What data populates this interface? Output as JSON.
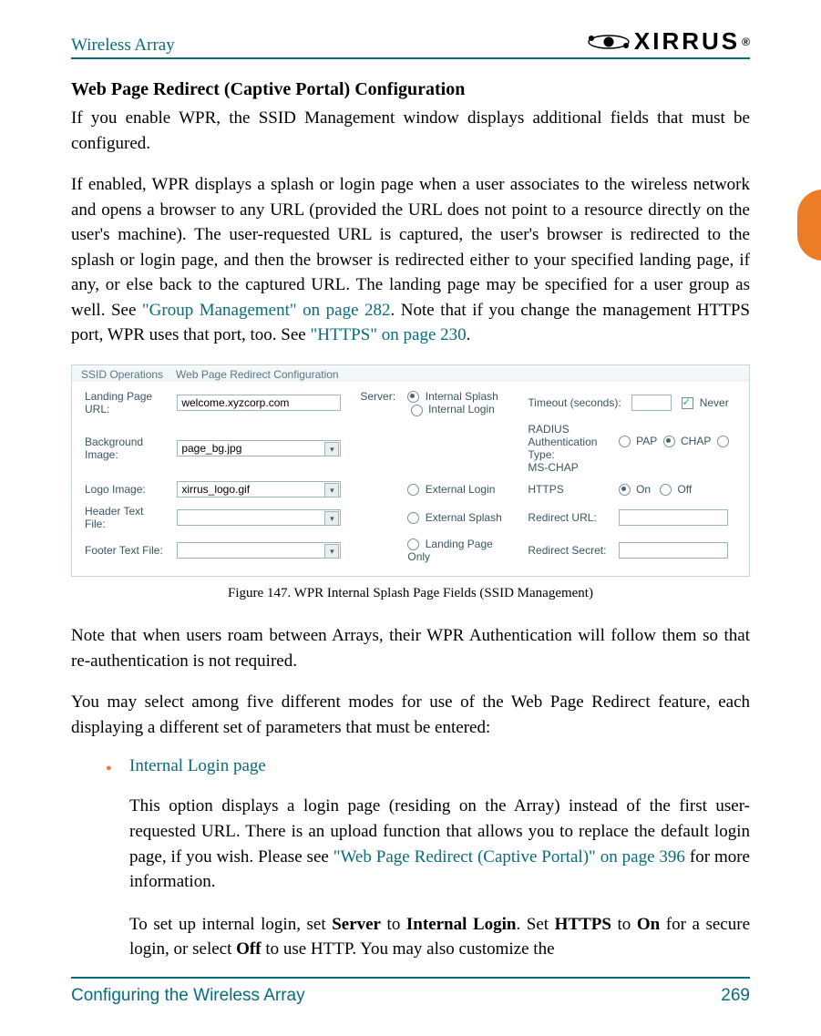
{
  "header": {
    "left": "Wireless Array",
    "brand": "XIRRUS"
  },
  "section_title": "Web Page Redirect (Captive Portal) Configuration",
  "para1": "If you enable WPR, the SSID Management window displays additional fields that must be configured.",
  "para2a": "If enabled, WPR displays a splash or login page when a user associates to the wireless network and opens a browser to any URL (provided the URL does not point to a resource directly on the user's machine). The user-requested URL is captured, the user's browser is redirected to the splash or login page, and then the browser is redirected either to your specified landing page, if any, or else back to the captured URL. The landing page may be specified for a user group as well. See ",
  "xref1": "\"Group Management\" on page 282",
  "para2b": ". Note that if you change the management HTTPS port, WPR uses that port, too. See ",
  "xref2": "\"HTTPS\" on page 230",
  "para2c": ".",
  "figure": {
    "tab1": "SSID Operations",
    "tab2": "Web Page Redirect Configuration",
    "labels": {
      "landing": "Landing Page URL:",
      "bg": "Background Image:",
      "logo": "Logo Image:",
      "header": "Header Text File:",
      "footer": "Footer Text File:",
      "server": "Server:",
      "timeout": "Timeout (seconds):",
      "never": "Never",
      "radius": "RADIUS Authentication Type:",
      "https": "HTTPS",
      "redirect_url": "Redirect URL:",
      "redirect_secret": "Redirect Secret:"
    },
    "values": {
      "landing": "welcome.xyzcorp.com",
      "bg": "page_bg.jpg",
      "logo": "xirrus_logo.gif",
      "header": "",
      "footer": "",
      "timeout": "",
      "redirect_url": "",
      "redirect_secret": ""
    },
    "server_options": [
      "Internal Splash",
      "Internal Login",
      "External Login",
      "External Splash",
      "Landing Page Only"
    ],
    "radius_options": [
      "PAP",
      "CHAP",
      "MS-CHAP"
    ],
    "https_options": [
      "On",
      "Off"
    ]
  },
  "caption": "Figure 147. WPR Internal Splash Page Fields (SSID Management)",
  "para3": "Note that when users roam between Arrays, their WPR Authentication will follow them so that re-authentication is not required.",
  "para4": "You may select among five different modes for use of the Web Page Redirect feature, each displaying a different set of parameters that must be entered:",
  "bullet1": "Internal Login page",
  "sub1a": "This option displays a login page (residing on the Array) instead of the first user-requested URL. There is an upload function that allows you to replace the default login page, if you wish. Please see ",
  "xref3": "\"Web Page Redirect (Captive Portal)\" on page 396",
  "sub1b": " for more information.",
  "sub2a": "To set up internal login, set ",
  "sub2_server": "Server",
  "sub2b": " to ",
  "sub2_il": "Internal Login",
  "sub2c": ". Set ",
  "sub2_https": "HTTPS",
  "sub2d": " to ",
  "sub2_on": "On",
  "sub2e": " for a secure login, or select ",
  "sub2_off": "Off",
  "sub2f": " to use HTTP. You may also customize the",
  "footer": {
    "left": "Configuring the Wireless Array",
    "right": "269"
  }
}
